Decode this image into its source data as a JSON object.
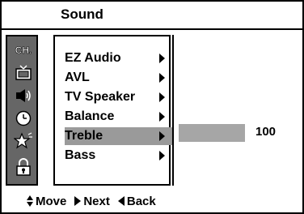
{
  "title": "Sound",
  "icons": [
    "channel-icon",
    "tv-icon",
    "speaker-icon",
    "clock-icon",
    "star-icon",
    "lock-icon"
  ],
  "channel_icon_text": "CH.",
  "menu": {
    "items": [
      {
        "label": "EZ Audio",
        "selected": false
      },
      {
        "label": "AVL",
        "selected": false
      },
      {
        "label": "TV Speaker",
        "selected": false
      },
      {
        "label": "Balance",
        "selected": false
      },
      {
        "label": "Treble",
        "selected": true
      },
      {
        "label": "Bass",
        "selected": false
      }
    ]
  },
  "value": {
    "number": "100",
    "level": 1.0
  },
  "nav": {
    "move": "Move",
    "next": "Next",
    "back": "Back"
  }
}
